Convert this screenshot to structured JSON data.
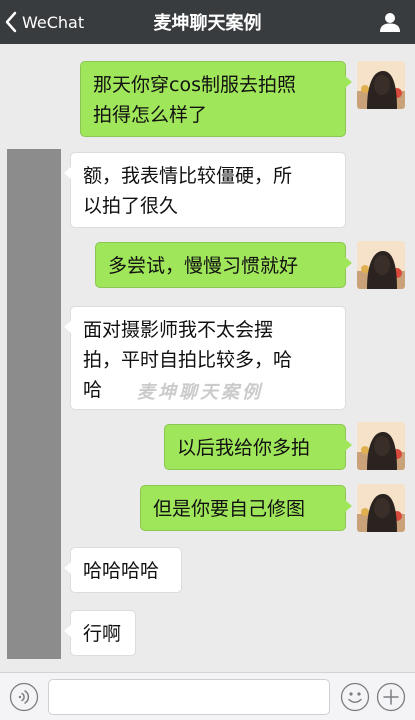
{
  "navbar": {
    "back_label": "WeChat",
    "title": "麦坤聊天案例"
  },
  "messages": [
    {
      "side": "out",
      "text_lines": [
        "那天你穿cos制服去拍照",
        "拍得怎么样了"
      ]
    },
    {
      "side": "in",
      "text_lines": [
        "额，我表情比较僵硬，所",
        "以拍了很久"
      ]
    },
    {
      "side": "out",
      "text_lines": [
        "多尝试，慢慢习惯就好"
      ]
    },
    {
      "side": "in",
      "text_lines": [
        "面对摄影师我不太会摆",
        "拍，平时自拍比较多，哈",
        "哈"
      ]
    },
    {
      "side": "out",
      "text_lines": [
        "以后我给你多拍"
      ]
    },
    {
      "side": "out",
      "text_lines": [
        "但是你要自己修图"
      ]
    },
    {
      "side": "in",
      "text_lines": [
        "哈哈哈哈"
      ]
    },
    {
      "side": "in",
      "text_lines": [
        "行啊"
      ]
    }
  ],
  "watermark": "麦坤聊天案例",
  "icons": {
    "back": "chevron-left-icon",
    "profile": "person-icon",
    "voice": "voice-icon",
    "emoji": "smiley-icon",
    "add": "plus-circle-icon"
  },
  "colors": {
    "navbar": "#383c3f",
    "background": "#ebebeb",
    "outgoing_bubble": "#a0e65a",
    "incoming_bubble": "#ffffff"
  }
}
